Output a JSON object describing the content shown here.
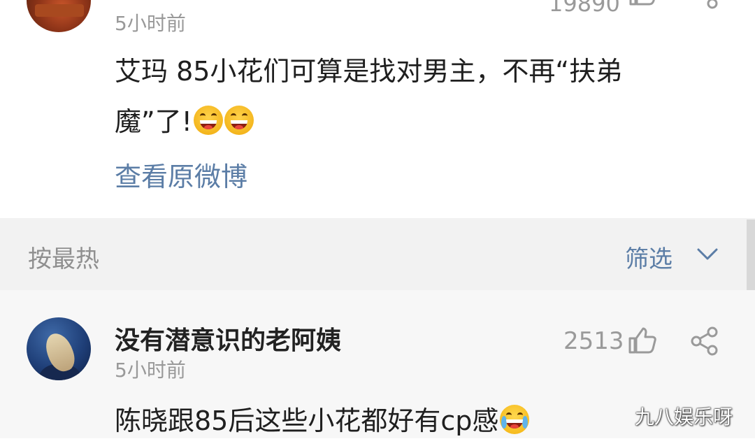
{
  "top_post": {
    "time": "5小时前",
    "count": "19890",
    "text_line1": "艾玛 85小花们可算是找对男主，不再“扶弟",
    "text_line2": "魔”了!",
    "view_original": "查看原微博"
  },
  "sort_bar": {
    "sort_label": "按最热",
    "filter_label": "筛选"
  },
  "comment": {
    "username": "没有潜意识的老阿姨",
    "time": "5小时前",
    "likes": "2513",
    "text": "陈晓跟85后这些小花都好有cp感"
  },
  "watermark": "九八娱乐呀",
  "colors": {
    "link": "#5b7da6",
    "muted": "#999999",
    "sort_bg": "#f2f2f2"
  },
  "icons": [
    "thumbs-up-icon",
    "share-icon",
    "chevron-down-icon",
    "grin-emoji",
    "crying-laugh-emoji"
  ]
}
